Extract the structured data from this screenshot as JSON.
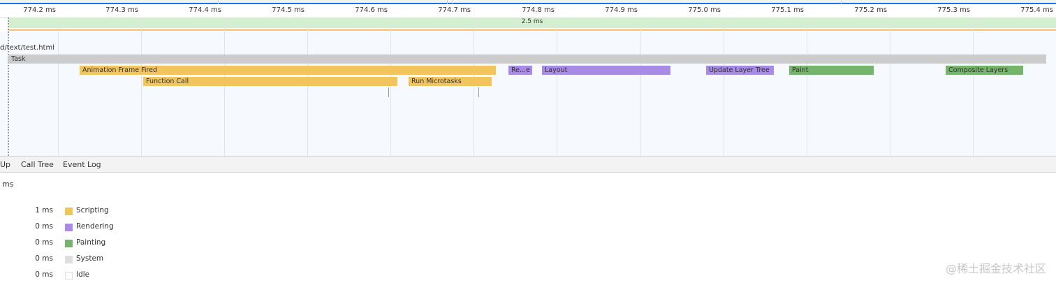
{
  "ruler": {
    "ticks": [
      "774.2 ms",
      "774.3 ms",
      "774.4 ms",
      "774.5 ms",
      "774.6 ms",
      "774.7 ms",
      "774.8 ms",
      "774.9 ms",
      "775.0 ms",
      "775.1 ms",
      "775.2 ms",
      "775.3 ms",
      "775.4 ms"
    ]
  },
  "frames": {
    "label": "2.5 ms"
  },
  "main_thread": {
    "url_label": "d/text/test.html",
    "events": [
      {
        "label": "Task",
        "category": "task"
      },
      {
        "label": "Animation Frame Fired",
        "category": "scripting"
      },
      {
        "label": "Function Call",
        "category": "scripting"
      },
      {
        "label": "Run Microtasks",
        "category": "scripting"
      },
      {
        "label": "Re...e",
        "category": "rendering"
      },
      {
        "label": "Layout",
        "category": "rendering"
      },
      {
        "label": "Update Layer Tree",
        "category": "rendering"
      },
      {
        "label": "Paint",
        "category": "painting"
      },
      {
        "label": "Composite Layers",
        "category": "painting"
      }
    ]
  },
  "tabs": [
    "Up",
    "Call Tree",
    "Event Log"
  ],
  "summary": {
    "range_text": "ms",
    "legend": [
      {
        "value": "1 ms",
        "name": "Scripting",
        "color": "#f2c55c"
      },
      {
        "value": "0 ms",
        "name": "Rendering",
        "color": "#a98ae6"
      },
      {
        "value": "0 ms",
        "name": "Painting",
        "color": "#75b56b"
      },
      {
        "value": "0 ms",
        "name": "System",
        "color": "#dedede"
      },
      {
        "value": "0 ms",
        "name": "Idle",
        "color": "#ffffff"
      }
    ]
  },
  "colors": {
    "accent": "#1a73e8",
    "scripting": "#f2c55c",
    "rendering": "#a98ae6",
    "painting": "#75b56b",
    "task": "#cccccc"
  },
  "watermark": "@稀土掘金技术社区"
}
